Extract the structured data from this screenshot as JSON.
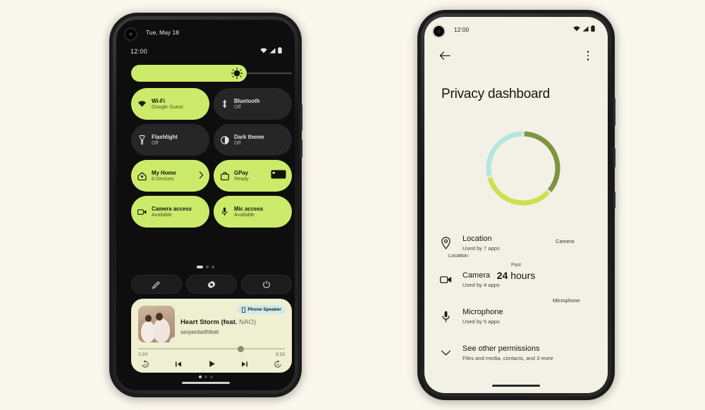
{
  "page": {
    "background_color": "#faf7ed",
    "accent_green": "#cdeb6a",
    "dark_surface": "#0e0e0e"
  },
  "left_phone": {
    "name": "quick-settings-panel",
    "status_bar": {
      "date": "Tue, May 18",
      "time": "12:00",
      "icons": [
        "wifi-icon",
        "signal-icon",
        "battery-icon"
      ]
    },
    "brightness": {
      "label": "brightness-slider",
      "value_percent": 72,
      "icon": "brightness-icon"
    },
    "tiles": [
      {
        "title": "Wi-Fi",
        "subtitle": "Google Guest",
        "state": "on",
        "icon": "wifi-icon"
      },
      {
        "title": "Bluetooth",
        "subtitle": "Off",
        "state": "off",
        "icon": "bluetooth-icon"
      },
      {
        "title": "Flashlight",
        "subtitle": "Off",
        "state": "off",
        "icon": "flashlight-icon"
      },
      {
        "title": "Dark theme",
        "subtitle": "Off",
        "state": "off",
        "icon": "dark-theme-icon"
      },
      {
        "title": "My Home",
        "subtitle": "6 Devices",
        "state": "on",
        "icon": "home-icon",
        "trailing": "chevron-right-icon"
      },
      {
        "title": "GPay",
        "subtitle": "Ready",
        "state": "on",
        "icon": "wallet-icon",
        "trailing": "card-icon"
      },
      {
        "title": "Camera access",
        "subtitle": "Available",
        "state": "on",
        "icon": "camera-icon"
      },
      {
        "title": "Mic access",
        "subtitle": "Available",
        "state": "on",
        "icon": "microphone-icon"
      }
    ],
    "page_dots": {
      "count": 3,
      "active_index": 0
    },
    "action_buttons": [
      {
        "name": "edit-tiles-button",
        "icon": "pencil-icon"
      },
      {
        "name": "settings-button",
        "icon": "gear-icon"
      },
      {
        "name": "power-button",
        "icon": "power-icon"
      }
    ],
    "media_player": {
      "output_chip": {
        "label": "Phone Speaker",
        "icon": "phone-icon"
      },
      "title": "Heart Storm (feat.",
      "title_feature": "NAO)",
      "artist": "serpentwithfeet",
      "album_art_badge": "youtube-music-icon",
      "elapsed": "2:20",
      "duration": "3:32",
      "progress_percent": 70,
      "controls": [
        {
          "name": "replay-10-button",
          "icon": "replay-10-icon"
        },
        {
          "name": "previous-button",
          "icon": "skip-previous-icon"
        },
        {
          "name": "play-button",
          "icon": "play-icon"
        },
        {
          "name": "next-button",
          "icon": "skip-next-icon"
        },
        {
          "name": "forward-30-button",
          "icon": "forward-30-icon"
        }
      ]
    },
    "media_dots": {
      "count": 3,
      "active_index": 0
    }
  },
  "right_phone": {
    "name": "privacy-dashboard-screen",
    "status_bar": {
      "time": "12:00",
      "icons": [
        "wifi-icon",
        "signal-icon",
        "battery-icon"
      ]
    },
    "app_bar": {
      "back": "back-arrow-icon",
      "overflow": "more-options-icon"
    },
    "title": "Privacy dashboard",
    "chart_data": {
      "type": "pie",
      "title": "Privacy usage, past 24 hours",
      "center_label_top": "Past",
      "center_label_value": "24",
      "center_label_unit": "hours",
      "categories": [
        "Camera",
        "Microphone",
        "Location"
      ],
      "values": [
        33,
        31,
        26
      ],
      "colors": [
        "#7d9442",
        "#cbe24f",
        "#b4e6e0"
      ],
      "labels_position": "outside",
      "legend": "none",
      "grid": false
    },
    "permissions": [
      {
        "title": "Location",
        "subtitle": "Used by 7 apps",
        "icon": "location-pin-icon"
      },
      {
        "title": "Camera",
        "subtitle": "Used by 4 apps",
        "icon": "camera-icon"
      },
      {
        "title": "Microphone",
        "subtitle": "Used by 5 apps",
        "icon": "microphone-icon"
      },
      {
        "title": "See other permissions",
        "subtitle": "Files and media, contacts, and 3 more",
        "icon": "chevron-down-icon"
      }
    ]
  }
}
